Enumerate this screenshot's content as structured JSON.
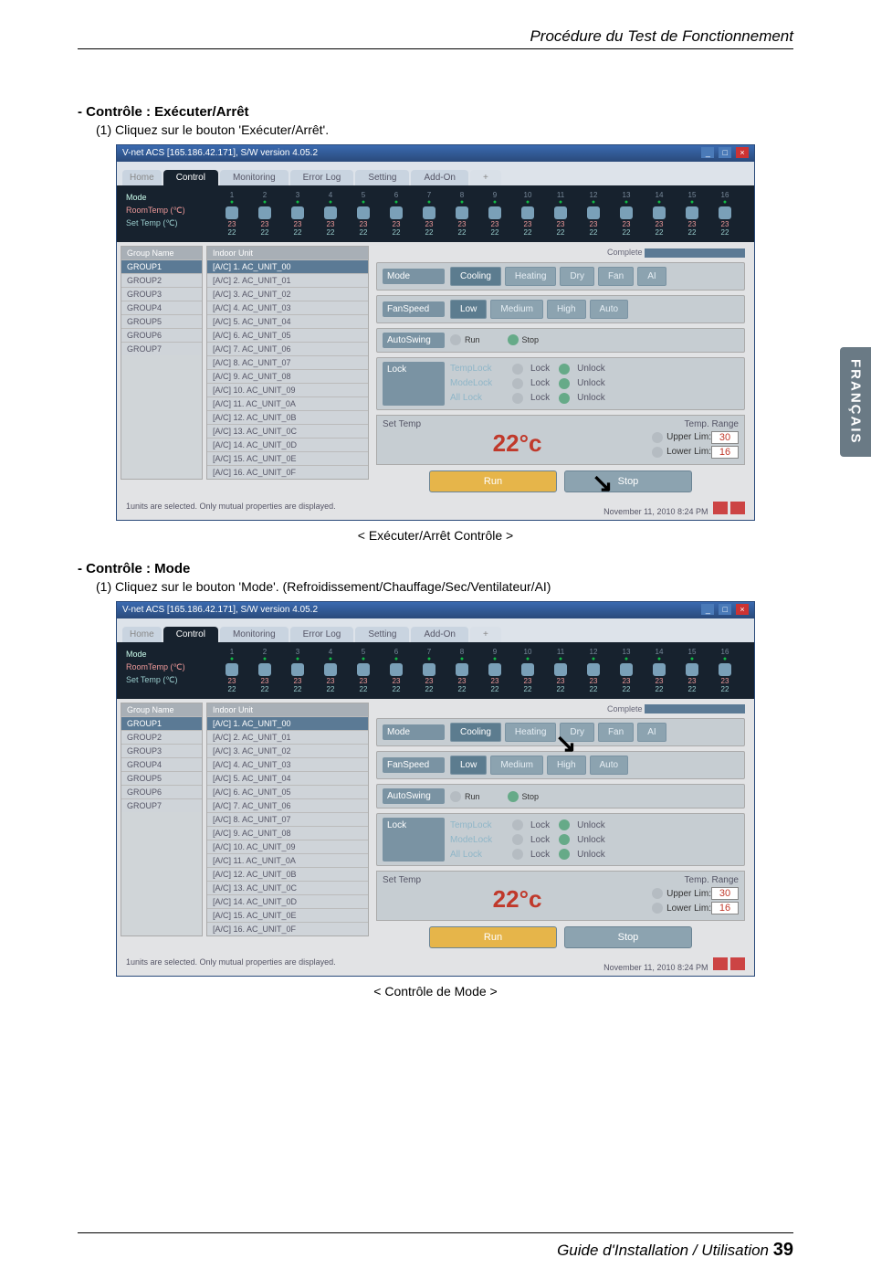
{
  "header": "Procédure du Test de Fonctionnement",
  "side_tab": "FRANÇAIS",
  "sec1": {
    "title": "- Contrôle : Exécuter/Arrêt",
    "step": "(1) Cliquez sur le bouton 'Exécuter/Arrêt'.",
    "caption": "< Exécuter/Arrêt Contrôle >"
  },
  "sec2": {
    "title": "- Contrôle : Mode",
    "step": "(1) Cliquez sur le bouton 'Mode'. (Refroidissement/Chauffage/Sec/Ventilateur/AI)",
    "caption": "< Contrôle de Mode >"
  },
  "footer": {
    "text": "Guide d'Installation / Utilisation",
    "page": "39"
  },
  "win": {
    "title": "V-net ACS [165.186.42.171],   S/W version 4.05.2",
    "tabs": {
      "home": "Home",
      "control": "Control",
      "monitoring": "Monitoring",
      "errorlog": "Error Log",
      "setting": "Setting",
      "addon": "Add-On"
    },
    "strip": {
      "mode": "Mode",
      "room": "RoomTemp (℃)",
      "set": "Set Temp  (℃)",
      "rval": "23",
      "sval": "22",
      "count": 16
    },
    "grp_hdr": "Group Name",
    "groups": [
      "GROUP1",
      "GROUP2",
      "GROUP3",
      "GROUP4",
      "GROUP5",
      "GROUP6",
      "GROUP7"
    ],
    "unit_hdr": "Indoor Unit",
    "units": [
      "[A/C] 1. AC_UNIT_00",
      "[A/C] 2. AC_UNIT_01",
      "[A/C] 3. AC_UNIT_02",
      "[A/C] 4. AC_UNIT_03",
      "[A/C] 5. AC_UNIT_04",
      "[A/C] 6. AC_UNIT_05",
      "[A/C] 7. AC_UNIT_06",
      "[A/C] 8. AC_UNIT_07",
      "[A/C] 9. AC_UNIT_08",
      "[A/C] 10. AC_UNIT_09",
      "[A/C] 11. AC_UNIT_0A",
      "[A/C] 12. AC_UNIT_0B",
      "[A/C] 13. AC_UNIT_0C",
      "[A/C] 14. AC_UNIT_0D",
      "[A/C] 15. AC_UNIT_0E",
      "[A/C] 16. AC_UNIT_0F"
    ],
    "complete": "Complete",
    "ctl": {
      "mode_lbl": "Mode",
      "modes": [
        "Cooling",
        "Heating",
        "Dry",
        "Fan",
        "AI"
      ],
      "fan_lbl": "FanSpeed",
      "fans": [
        "Low",
        "Medium",
        "High",
        "Auto"
      ],
      "swing_lbl": "AutoSwing",
      "run": "Run",
      "stop": "Stop",
      "lock_lbl": "Lock",
      "locks": [
        {
          "name": "TempLock",
          "a": "Lock",
          "b": "Unlock"
        },
        {
          "name": "ModeLock",
          "a": "Lock",
          "b": "Unlock"
        },
        {
          "name": "All Lock",
          "a": "Lock",
          "b": "Unlock"
        }
      ],
      "settemp_lbl": "Set Temp",
      "range_lbl": "Temp. Range",
      "temp": "22°c",
      "upper_lbl": "Upper Lim:",
      "upper": "30",
      "lower_lbl": "Lower Lim:",
      "lower": "16",
      "runbtn": "Run",
      "stopbtn": "Stop"
    },
    "status": {
      "left": "1units are selected. Only mutual properties are displayed.",
      "right": "November 11, 2010  8:24 PM"
    }
  }
}
